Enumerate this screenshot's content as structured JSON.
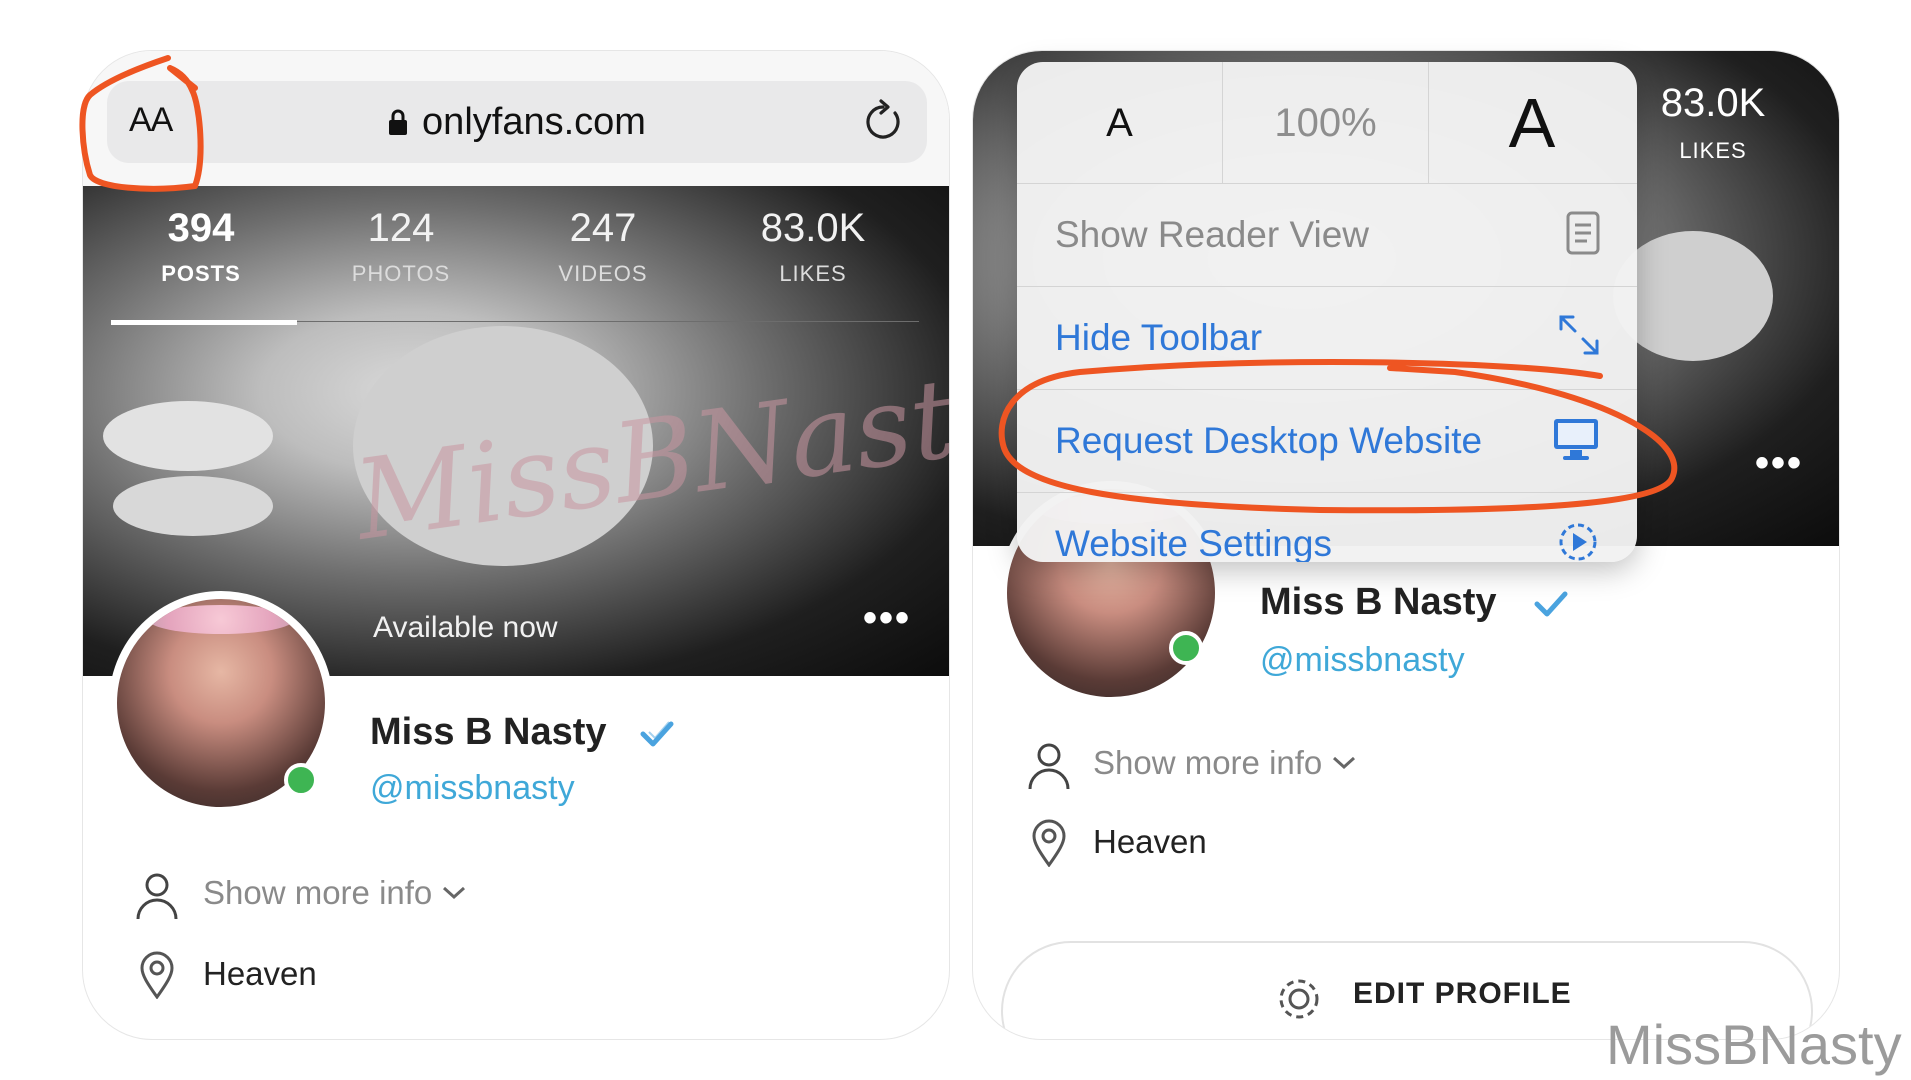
{
  "left": {
    "browser": {
      "aa": "AA",
      "url": "onlyfans.com"
    },
    "stats": [
      {
        "num": "394",
        "label": "POSTS"
      },
      {
        "num": "124",
        "label": "PHOTOS"
      },
      {
        "num": "247",
        "label": "VIDEOS"
      },
      {
        "num": "83.0K",
        "label": "LIKES"
      }
    ],
    "cover_watermark": "MissBNasty",
    "available": "Available now",
    "more": "•••",
    "profile": {
      "name": "Miss B Nasty",
      "handle": "@missbnasty",
      "show_more": "Show more info",
      "location": "Heaven"
    }
  },
  "right": {
    "likes": {
      "num": "83.0K",
      "label": "LIKES"
    },
    "more": "•••",
    "profile": {
      "name": "Miss B Nasty",
      "handle": "@missbnasty",
      "show_more": "Show more info",
      "location": "Heaven"
    },
    "edit_profile": "EDIT PROFILE",
    "popup": {
      "zoom_small": "A",
      "zoom_percent": "100%",
      "zoom_large": "A",
      "items": [
        {
          "label": "Show Reader View",
          "icon": "reader-icon"
        },
        {
          "label": "Hide Toolbar",
          "icon": "expand-icon"
        },
        {
          "label": "Request Desktop Website",
          "icon": "desktop-icon"
        },
        {
          "label": "Website Settings",
          "icon": "settings-icon"
        }
      ]
    }
  },
  "watermark": "MissBNasty",
  "colors": {
    "link_blue": "#2f78d8",
    "handle_blue": "#3fa8d8",
    "verified": "#4aa3df",
    "online": "#3eb553",
    "annotation": "#ee5522"
  }
}
